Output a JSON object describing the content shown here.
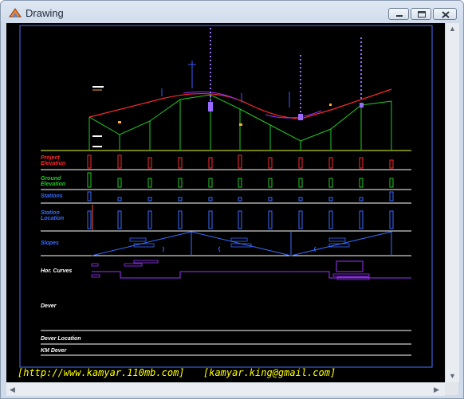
{
  "window": {
    "title": "Drawing"
  },
  "colors": {
    "profile": "#ff2a2a",
    "ground": "#22cc22",
    "frame": "#4d6fff",
    "text": "#ffffff",
    "footer": "#ffff00",
    "curves": "#9a33ff"
  },
  "bands": {
    "project_elevation": "Project\nElevation",
    "project_elevation_l1": "Project",
    "project_elevation_l2": "Elevation",
    "ground_elevation_l1": "Ground",
    "ground_elevation_l2": "Elevation",
    "stations": "Stations",
    "station_location_l1": "Station",
    "station_location_l2": "Location",
    "slopes": "Slopes",
    "hor_curves": "Hor. Curves",
    "dever": "Dever",
    "dever_location": "Dever Location",
    "km_dever": "KM Dever"
  },
  "footer": {
    "url": "[http://www.kamyar.110mb.com]",
    "email": "[kamyar.king@gmail.com]"
  },
  "icons": {
    "app": "drawing-app-icon",
    "minimize": "minimize-icon",
    "maximize": "maximize-icon",
    "close": "close-icon"
  }
}
